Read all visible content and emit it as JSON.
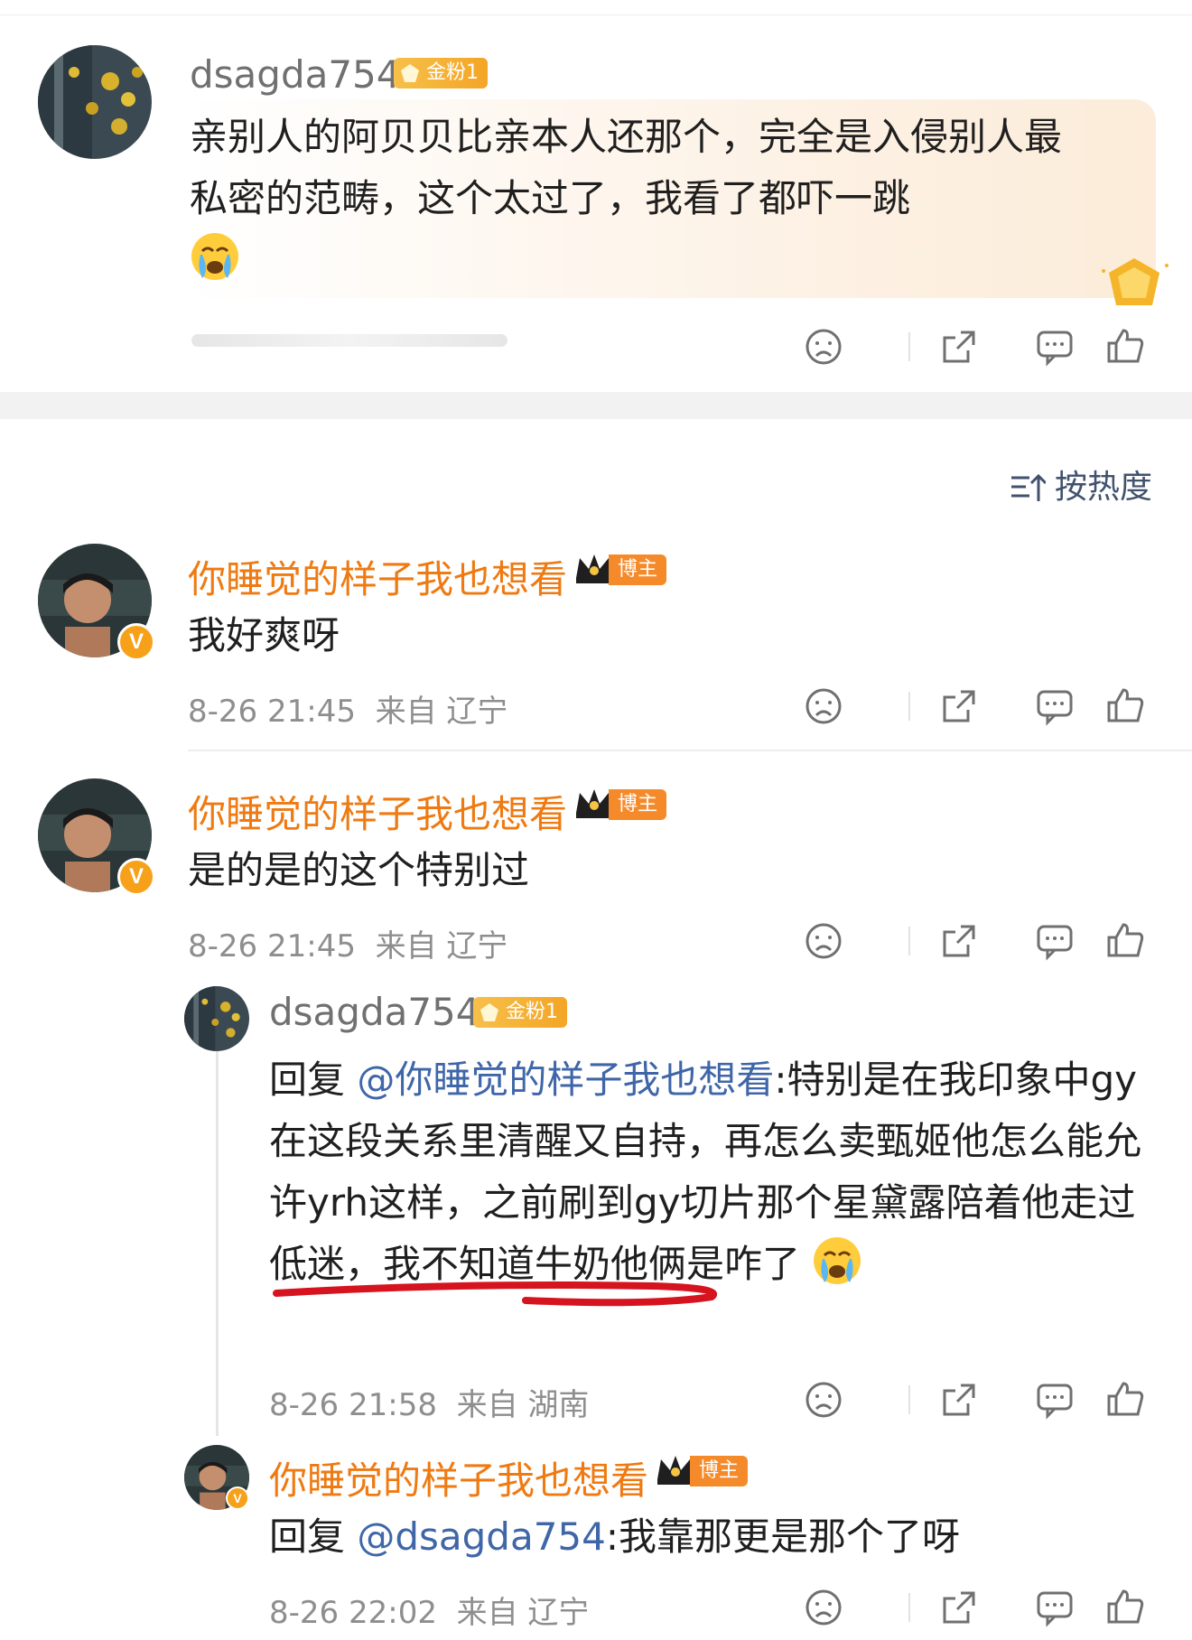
{
  "original_post": {
    "username": "dsagda754",
    "fan_badge": "金粉1",
    "text": "亲别人的阿贝贝比亲本人还那个，完全是入侵别人最私密的范畴，这个太过了，我看了都吓一跳",
    "emoji": "crying-face-icon"
  },
  "sort": {
    "label": "按热度",
    "icon": "sort-icon"
  },
  "comments": [
    {
      "username": "你睡觉的样子我也想看",
      "role_badge": "博主",
      "text": "我好爽呀",
      "time": "8-26 21:45",
      "location": "来自 辽宁"
    },
    {
      "username": "你睡觉的样子我也想看",
      "role_badge": "博主",
      "text": "是的是的这个特别过",
      "time": "8-26 21:45",
      "location": "来自 辽宁"
    }
  ],
  "replies": [
    {
      "username": "dsagda754",
      "fan_badge": "金粉1",
      "reply_prefix": "回复 ",
      "mention": "@你睡觉的样子我也想看",
      "text": ":特别是在我印象中gy在这段关系里清醒又自持，再怎么卖甄姬他怎么能允许yrh这样，之前刷到gy切片那个星黛露陪着他走过低迷，我不知道牛奶他俩是咋了",
      "time": "8-26 21:58",
      "location": "来自 湖南"
    },
    {
      "username": "你睡觉的样子我也想看",
      "role_badge": "博主",
      "reply_prefix": "回复 ",
      "mention": "@dsagda754",
      "text": ":我靠那更是那个了呀",
      "time": "8-26 22:02",
      "location": "来自 辽宁"
    }
  ],
  "colors": {
    "accent_orange": "#ef7a12",
    "mention_blue": "#3f66a8",
    "underline_red": "#d6141f",
    "gold_badge": "#f4a526"
  }
}
